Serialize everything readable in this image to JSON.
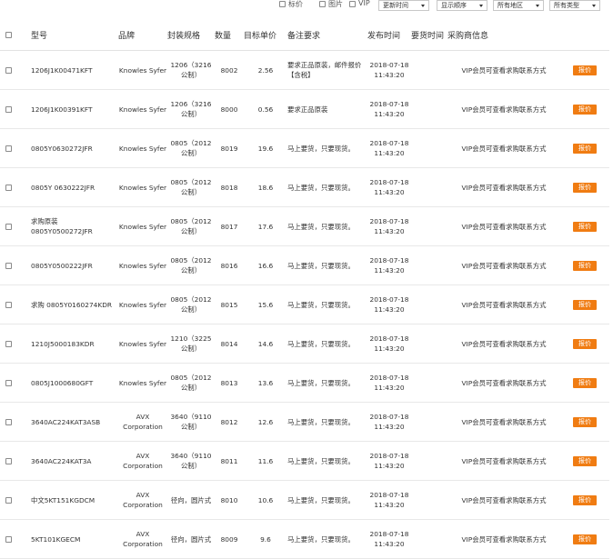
{
  "filters": {
    "checkbox_labels": [
      "标价",
      "图片",
      "VIP"
    ],
    "selects": [
      "更新时间",
      "显示顺序",
      "所有地区",
      "所有类型"
    ]
  },
  "columns": [
    "型号",
    "品牌",
    "封装规格",
    "数量",
    "目标单价",
    "备注要求",
    "发布时间",
    "要货时间",
    "采购商信息",
    ""
  ],
  "quote_label": "报价",
  "rows": [
    {
      "model": "1206J1K00471KFT",
      "brand": "Knowles Syfer",
      "package": "1206（3216 公制）",
      "qty": "8002",
      "price": "2.56",
      "remark": "要求正品原装，邮件报价【含税】",
      "date": "2018-07-18 11:43:20",
      "need": "",
      "buyer": "VIP会员可查看求购联系方式"
    },
    {
      "model": "1206J1K00391KFT",
      "brand": "Knowles Syfer",
      "package": "1206（3216 公制）",
      "qty": "8000",
      "price": "0.56",
      "remark": "要求正品原装",
      "date": "2018-07-18 11:43:20",
      "need": "",
      "buyer": "VIP会员可查看求购联系方式"
    },
    {
      "model": "0805Y0630272JFR",
      "brand": "Knowles Syfer",
      "package": "0805（2012 公制）",
      "qty": "8019",
      "price": "19.6",
      "remark": "马上要货，只要现货。",
      "date": "2018-07-18 11:43:20",
      "need": "",
      "buyer": "VIP会员可查看求购联系方式"
    },
    {
      "model": "0805Y 0630222JFR",
      "brand": "Knowles Syfer",
      "package": "0805（2012 公制）",
      "qty": "8018",
      "price": "18.6",
      "remark": "马上要货，只要现货。",
      "date": "2018-07-18 11:43:20",
      "need": "",
      "buyer": "VIP会员可查看求购联系方式"
    },
    {
      "model": "求购原装 0805Y0500272JFR",
      "brand": "Knowles Syfer",
      "package": "0805（2012 公制）",
      "qty": "8017",
      "price": "17.6",
      "remark": "马上要货，只要现货。",
      "date": "2018-07-18 11:43:20",
      "need": "",
      "buyer": "VIP会员可查看求购联系方式"
    },
    {
      "model": "0805Y0500222JFR",
      "brand": "Knowles Syfer",
      "package": "0805（2012 公制）",
      "qty": "8016",
      "price": "16.6",
      "remark": "马上要货，只要现货。",
      "date": "2018-07-18 11:43:20",
      "need": "",
      "buyer": "VIP会员可查看求购联系方式"
    },
    {
      "model": "求购 0805Y0160274KDR",
      "brand": "Knowles Syfer",
      "package": "0805（2012 公制）",
      "qty": "8015",
      "price": "15.6",
      "remark": "马上要货，只要现货。",
      "date": "2018-07-18 11:43:20",
      "need": "",
      "buyer": "VIP会员可查看求购联系方式"
    },
    {
      "model": "1210J5000183KDR",
      "brand": "Knowles Syfer",
      "package": "1210（3225 公制）",
      "qty": "8014",
      "price": "14.6",
      "remark": "马上要货，只要现货。",
      "date": "2018-07-18 11:43:20",
      "need": "",
      "buyer": "VIP会员可查看求购联系方式"
    },
    {
      "model": "0805J1000680GFT",
      "brand": "Knowles Syfer",
      "package": "0805（2012 公制）",
      "qty": "8013",
      "price": "13.6",
      "remark": "马上要货，只要现货。",
      "date": "2018-07-18 11:43:20",
      "need": "",
      "buyer": "VIP会员可查看求购联系方式"
    },
    {
      "model": "3640AC224KAT3ASB",
      "brand": "AVX Corporation",
      "package": "3640（9110 公制）",
      "qty": "8012",
      "price": "12.6",
      "remark": "马上要货，只要现货。",
      "date": "2018-07-18 11:43:20",
      "need": "",
      "buyer": "VIP会员可查看求购联系方式"
    },
    {
      "model": "3640AC224KAT3A",
      "brand": "AVX Corporation",
      "package": "3640（9110 公制）",
      "qty": "8011",
      "price": "11.6",
      "remark": "马上要货，只要现货。",
      "date": "2018-07-18 11:43:20",
      "need": "",
      "buyer": "VIP会员可查看求购联系方式"
    },
    {
      "model": "中文5KT151KGDCM",
      "brand": "AVX Corporation",
      "package": "径向，圆片式",
      "qty": "8010",
      "price": "10.6",
      "remark": "马上要货，只要现货。",
      "date": "2018-07-18 11:43:20",
      "need": "",
      "buyer": "VIP会员可查看求购联系方式"
    },
    {
      "model": "5KT101KGECM",
      "brand": "AVX Corporation",
      "package": "径向，圆片式",
      "qty": "8009",
      "price": "9.6",
      "remark": "马上要货，只要现货。",
      "date": "2018-07-18 11:43:20",
      "need": "",
      "buyer": "VIP会员可查看求购联系方式"
    }
  ]
}
